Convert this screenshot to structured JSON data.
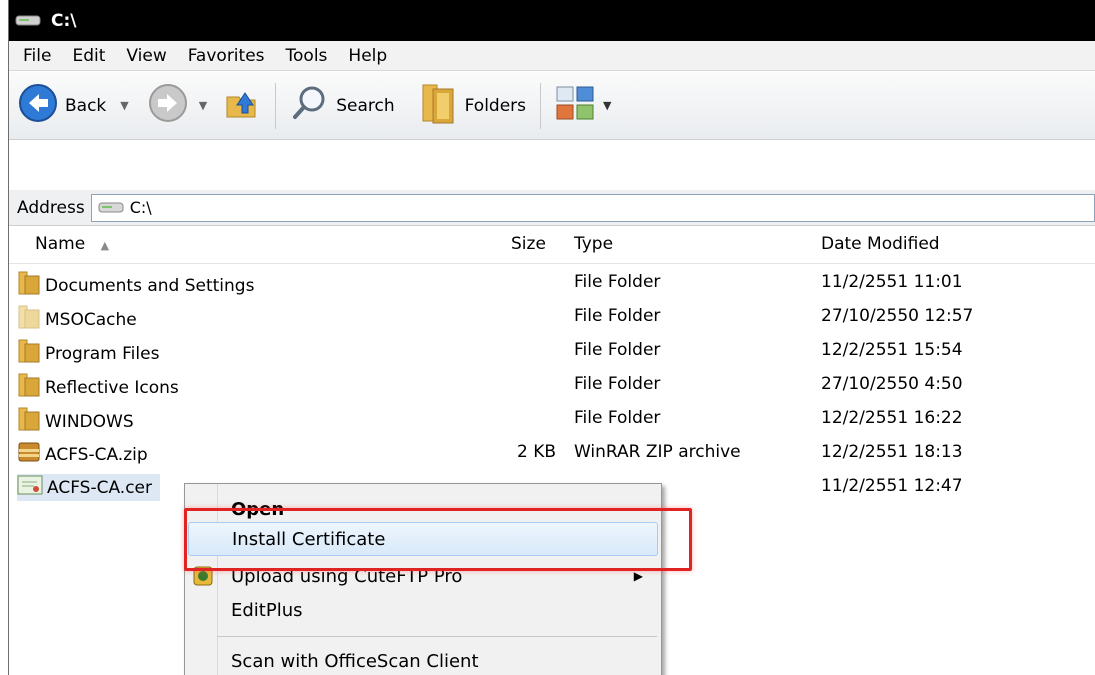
{
  "window": {
    "title": "C:\\"
  },
  "menubar": {
    "items": [
      "File",
      "Edit",
      "View",
      "Favorites",
      "Tools",
      "Help"
    ]
  },
  "toolbar": {
    "back": "Back",
    "search": "Search",
    "folders": "Folders"
  },
  "address": {
    "label": "Address",
    "value": "C:\\"
  },
  "list": {
    "headers": {
      "name": "Name",
      "size": "Size",
      "type": "Type",
      "date": "Date Modified"
    },
    "rows": [
      {
        "name": "Documents and Settings",
        "size": "",
        "type": "File Folder",
        "date": "11/2/2551 11:01"
      },
      {
        "name": "MSOCache",
        "size": "",
        "type": "File Folder",
        "date": "27/10/2550 12:57"
      },
      {
        "name": "Program Files",
        "size": "",
        "type": "File Folder",
        "date": "12/2/2551 15:54"
      },
      {
        "name": "Reflective Icons",
        "size": "",
        "type": "File Folder",
        "date": "27/10/2550 4:50"
      },
      {
        "name": "WINDOWS",
        "size": "",
        "type": "File Folder",
        "date": "12/2/2551 16:22"
      },
      {
        "name": "ACFS-CA.zip",
        "size": "2 KB",
        "type": "WinRAR ZIP archive",
        "date": "12/2/2551 18:13"
      },
      {
        "name": "ACFS-CA.cer",
        "size": "",
        "type": "",
        "date": "11/2/2551 12:47"
      }
    ]
  },
  "context_menu": {
    "open": "Open",
    "install": "Install Certificate",
    "upload": "Upload using CuteFTP Pro",
    "editplus": "EditPlus",
    "scan": "Scan with OfficeScan Client"
  },
  "colors": {
    "highlight": "#e02424",
    "folder": "#e8b94a",
    "selection": "#dde8f4"
  }
}
